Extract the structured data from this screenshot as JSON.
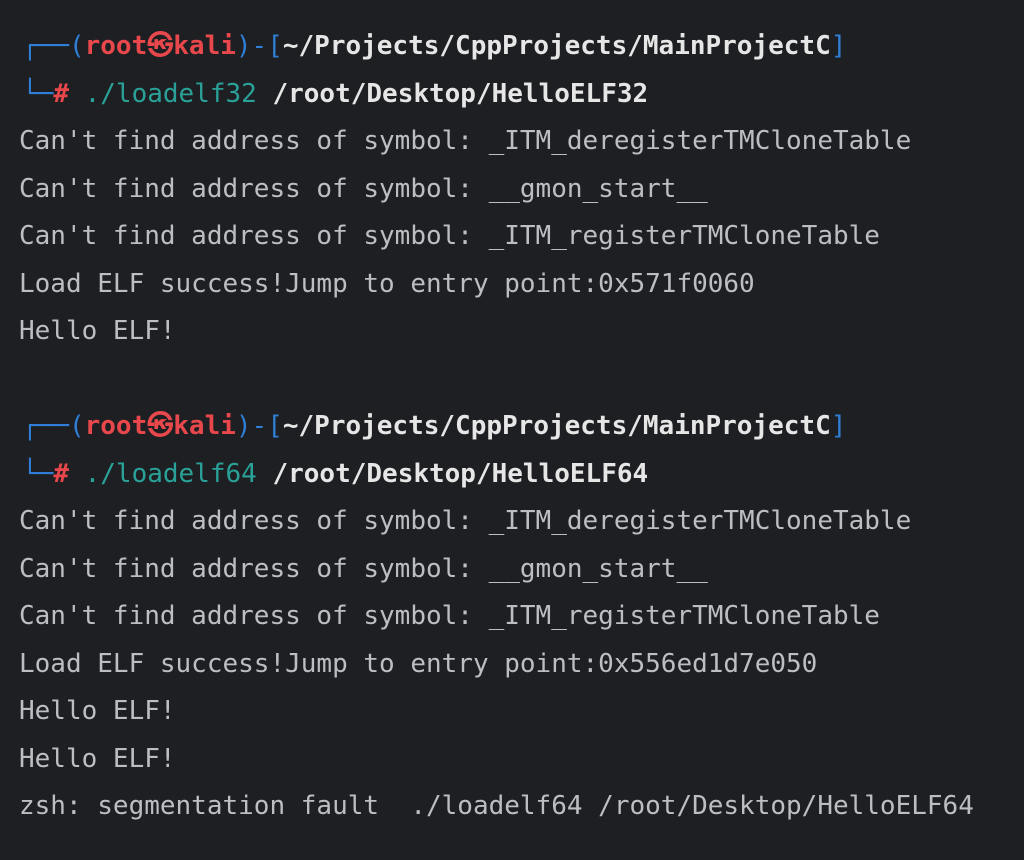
{
  "colors": {
    "background": "#1e1f22",
    "frame": "#2f7fd6",
    "user_host": "#e8484b",
    "command": "#2aa198",
    "output": "#bcbec4",
    "path": "#e6e6e6"
  },
  "sessions": [
    {
      "prompt": {
        "frame_top": "┌──(",
        "user": "root",
        "separator_icon": "㉿",
        "host": "kali",
        "frame_mid": ")-[",
        "cwd": "~/Projects/CppProjects/MainProjectC",
        "frame_end": "]",
        "frame_bottom": "└─",
        "symbol": "#"
      },
      "command": "./loadelf32",
      "argument": "/root/Desktop/HelloELF32",
      "output": [
        "Can't find address of symbol: _ITM_deregisterTMCloneTable",
        "Can't find address of symbol: __gmon_start__",
        "Can't find address of symbol: _ITM_registerTMCloneTable",
        "Load ELF success!Jump to entry point:0x571f0060",
        "Hello ELF!"
      ]
    },
    {
      "prompt": {
        "frame_top": "┌──(",
        "user": "root",
        "separator_icon": "㉿",
        "host": "kali",
        "frame_mid": ")-[",
        "cwd": "~/Projects/CppProjects/MainProjectC",
        "frame_end": "]",
        "frame_bottom": "└─",
        "symbol": "#"
      },
      "command": "./loadelf64",
      "argument": "/root/Desktop/HelloELF64",
      "output": [
        "Can't find address of symbol: _ITM_deregisterTMCloneTable",
        "Can't find address of symbol: __gmon_start__",
        "Can't find address of symbol: _ITM_registerTMCloneTable",
        "Load ELF success!Jump to entry point:0x556ed1d7e050",
        "Hello ELF!",
        "Hello ELF!",
        "zsh: segmentation fault  ./loadelf64 /root/Desktop/HelloELF64"
      ]
    }
  ]
}
